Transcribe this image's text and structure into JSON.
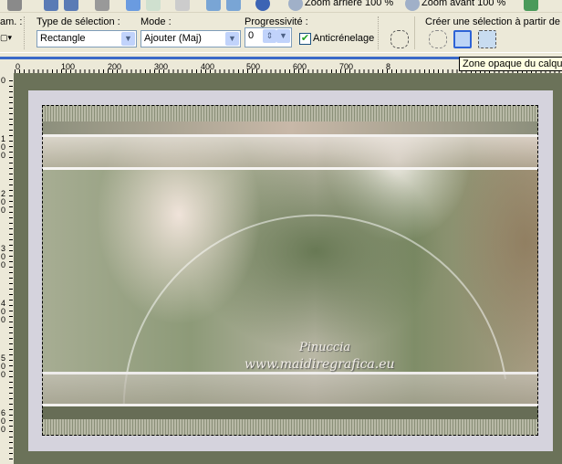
{
  "toolbar": {
    "zoom_out": "Zoom arrière 100 %",
    "zoom_in": "Zoom avant 100 %"
  },
  "options": {
    "left_cut_label": "am. :",
    "selection_type": {
      "label": "Type de sélection :",
      "value": "Rectangle"
    },
    "mode": {
      "label": "Mode :",
      "value": "Ajouter (Maj)"
    },
    "feather": {
      "label": "Progressivité :",
      "value": "0"
    },
    "antialias": {
      "label": "Anticrénelage",
      "checked": true
    },
    "create_from": {
      "label": "Créer une sélection à partir de :"
    }
  },
  "tooltip": "Zone opaque du calque",
  "ruler_h": [
    "0",
    "100",
    "200",
    "300",
    "400",
    "500",
    "600",
    "700",
    "8"
  ],
  "ruler_v": [
    "0",
    "1\n0\n0",
    "2\n0\n0",
    "3\n0\n0",
    "4\n0\n0",
    "5\n0\n0",
    "6\n0\n0"
  ],
  "watermark": {
    "line1": "Pinuccia",
    "line2": "www.maidiregrafica.eu"
  },
  "colors": {
    "canvas": "#6b7259",
    "frame": "#d5d3dd",
    "accent": "#3a6ac8"
  }
}
